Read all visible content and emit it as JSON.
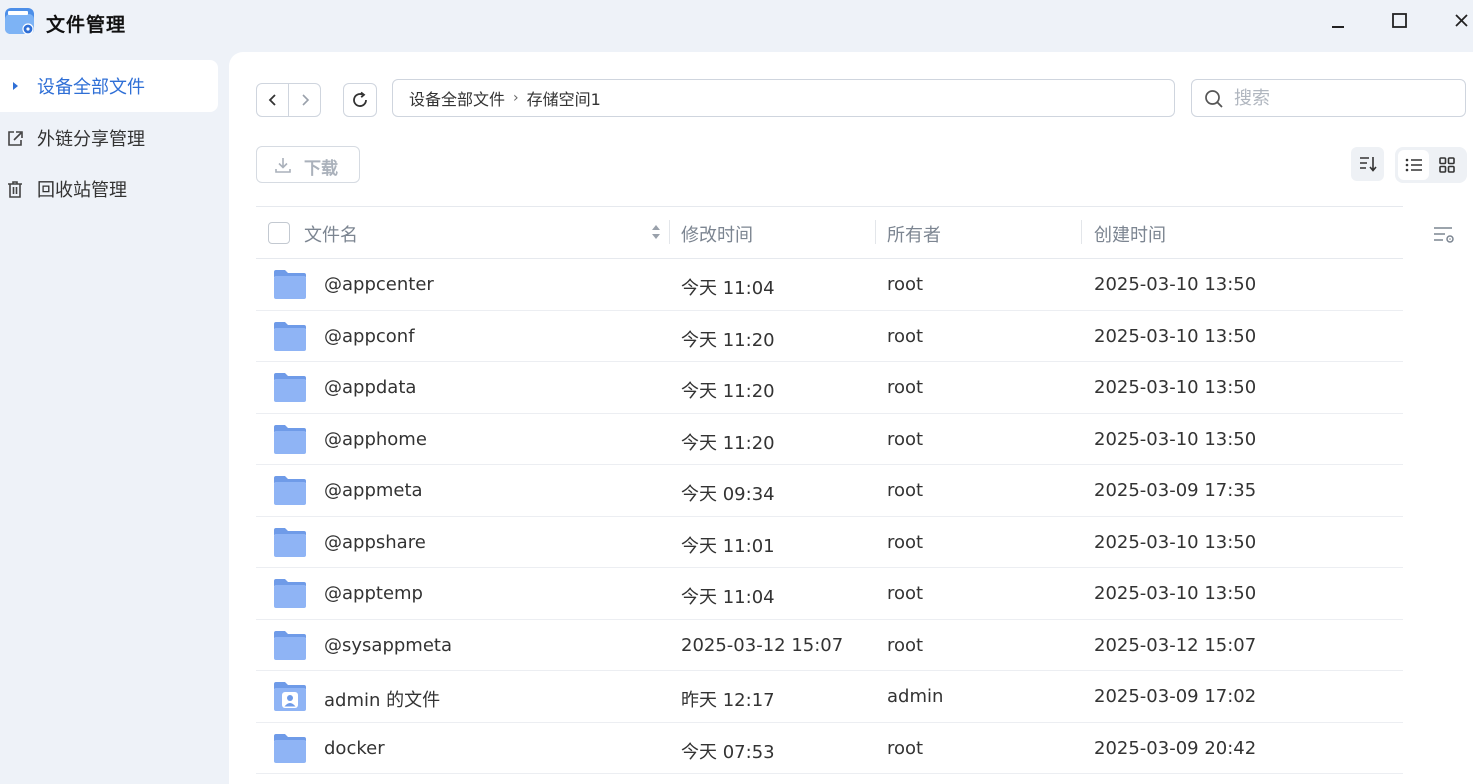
{
  "app": {
    "title": "文件管理"
  },
  "sidebar": {
    "items": [
      {
        "label": "设备全部文件",
        "active": true
      },
      {
        "label": "外链分享管理",
        "active": false
      },
      {
        "label": "回收站管理",
        "active": false
      }
    ]
  },
  "toolbar": {
    "breadcrumb": [
      "设备全部文件",
      "存储空间1"
    ],
    "search_placeholder": "搜索",
    "download_label": "下载"
  },
  "table": {
    "columns": [
      "文件名",
      "修改时间",
      "所有者",
      "创建时间"
    ],
    "rows": [
      {
        "name": "@appcenter",
        "modified": "今天 11:04",
        "owner": "root",
        "created": "2025-03-10 13:50",
        "icon": "folder-icon"
      },
      {
        "name": "@appconf",
        "modified": "今天 11:20",
        "owner": "root",
        "created": "2025-03-10 13:50",
        "icon": "folder-icon"
      },
      {
        "name": "@appdata",
        "modified": "今天 11:20",
        "owner": "root",
        "created": "2025-03-10 13:50",
        "icon": "folder-icon"
      },
      {
        "name": "@apphome",
        "modified": "今天 11:20",
        "owner": "root",
        "created": "2025-03-10 13:50",
        "icon": "folder-icon"
      },
      {
        "name": "@appmeta",
        "modified": "今天 09:34",
        "owner": "root",
        "created": "2025-03-09 17:35",
        "icon": "folder-icon"
      },
      {
        "name": "@appshare",
        "modified": "今天 11:01",
        "owner": "root",
        "created": "2025-03-10 13:50",
        "icon": "folder-icon"
      },
      {
        "name": "@apptemp",
        "modified": "今天 11:04",
        "owner": "root",
        "created": "2025-03-10 13:50",
        "icon": "folder-icon"
      },
      {
        "name": "@sysappmeta",
        "modified": "2025-03-12 15:07",
        "owner": "root",
        "created": "2025-03-12 15:07",
        "icon": "folder-icon"
      },
      {
        "name": "admin 的文件",
        "modified": "昨天 12:17",
        "owner": "admin",
        "created": "2025-03-09 17:02",
        "icon": "user-folder-icon"
      },
      {
        "name": "docker",
        "modified": "今天 07:53",
        "owner": "root",
        "created": "2025-03-09 20:42",
        "icon": "folder-icon"
      }
    ]
  },
  "colors": {
    "accent": "#2f6fd6",
    "folder": "#8fb4f5",
    "folder_tab": "#6f9be8"
  }
}
